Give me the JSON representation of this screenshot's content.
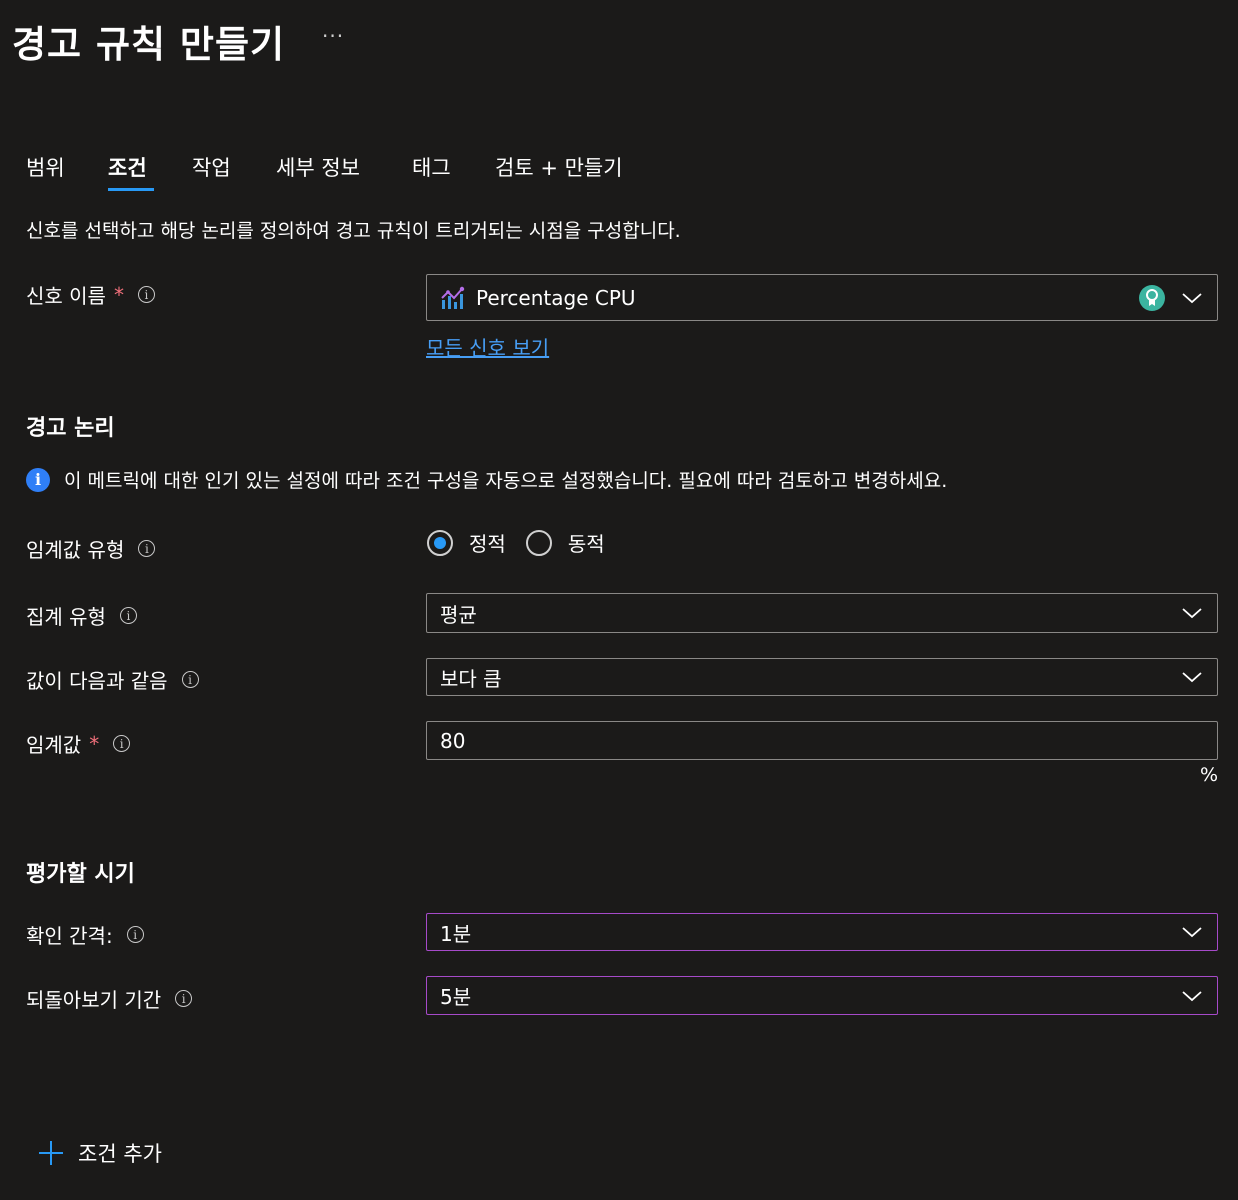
{
  "header": {
    "title": "경고 규칙 만들기",
    "more_label": "···"
  },
  "tabs": [
    {
      "label": "범위",
      "active": false
    },
    {
      "label": "조건",
      "active": true
    },
    {
      "label": "작업",
      "active": false
    },
    {
      "label": "세부 정보",
      "active": false
    },
    {
      "label": "태그",
      "active": false
    },
    {
      "label": "검토 + 만들기",
      "active": false
    }
  ],
  "description": "신호를 선택하고 해당 논리를 정의하여 경고 규칙이 트리거되는 시점을 구성합니다.",
  "signal": {
    "label": "신호 이름",
    "required_mark": "*",
    "value": "Percentage CPU",
    "see_all_link": "모든 신호 보기",
    "icon": "metric-chart-icon",
    "badge_icon": "recommended-badge-icon"
  },
  "alert_logic": {
    "heading": "경고 논리",
    "banner_text": "이 메트릭에 대한 인기 있는 설정에 따라 조건 구성을 자동으로 설정했습니다. 필요에 따라 검토하고 변경하세요.",
    "threshold_type": {
      "label": "임계값 유형",
      "options": [
        "정적",
        "동적"
      ],
      "selected": "정적"
    },
    "aggregation": {
      "label": "집계 유형",
      "value": "평균"
    },
    "operator": {
      "label": "값이 다음과 같음",
      "value": "보다 큼"
    },
    "threshold": {
      "label": "임계값",
      "required_mark": "*",
      "value": "80",
      "unit": "%"
    }
  },
  "evaluation": {
    "heading": "평가할 시기",
    "frequency": {
      "label": "확인 간격:",
      "value": "1분"
    },
    "lookback": {
      "label": "되돌아보기 기간",
      "value": "5분"
    }
  },
  "add_condition": {
    "label": "조건 추가"
  },
  "colors": {
    "background": "#1b1a19",
    "accent": "#2899f5",
    "link": "#479ef5",
    "required": "#f1707b",
    "highlight_border": "#a64ac9"
  }
}
